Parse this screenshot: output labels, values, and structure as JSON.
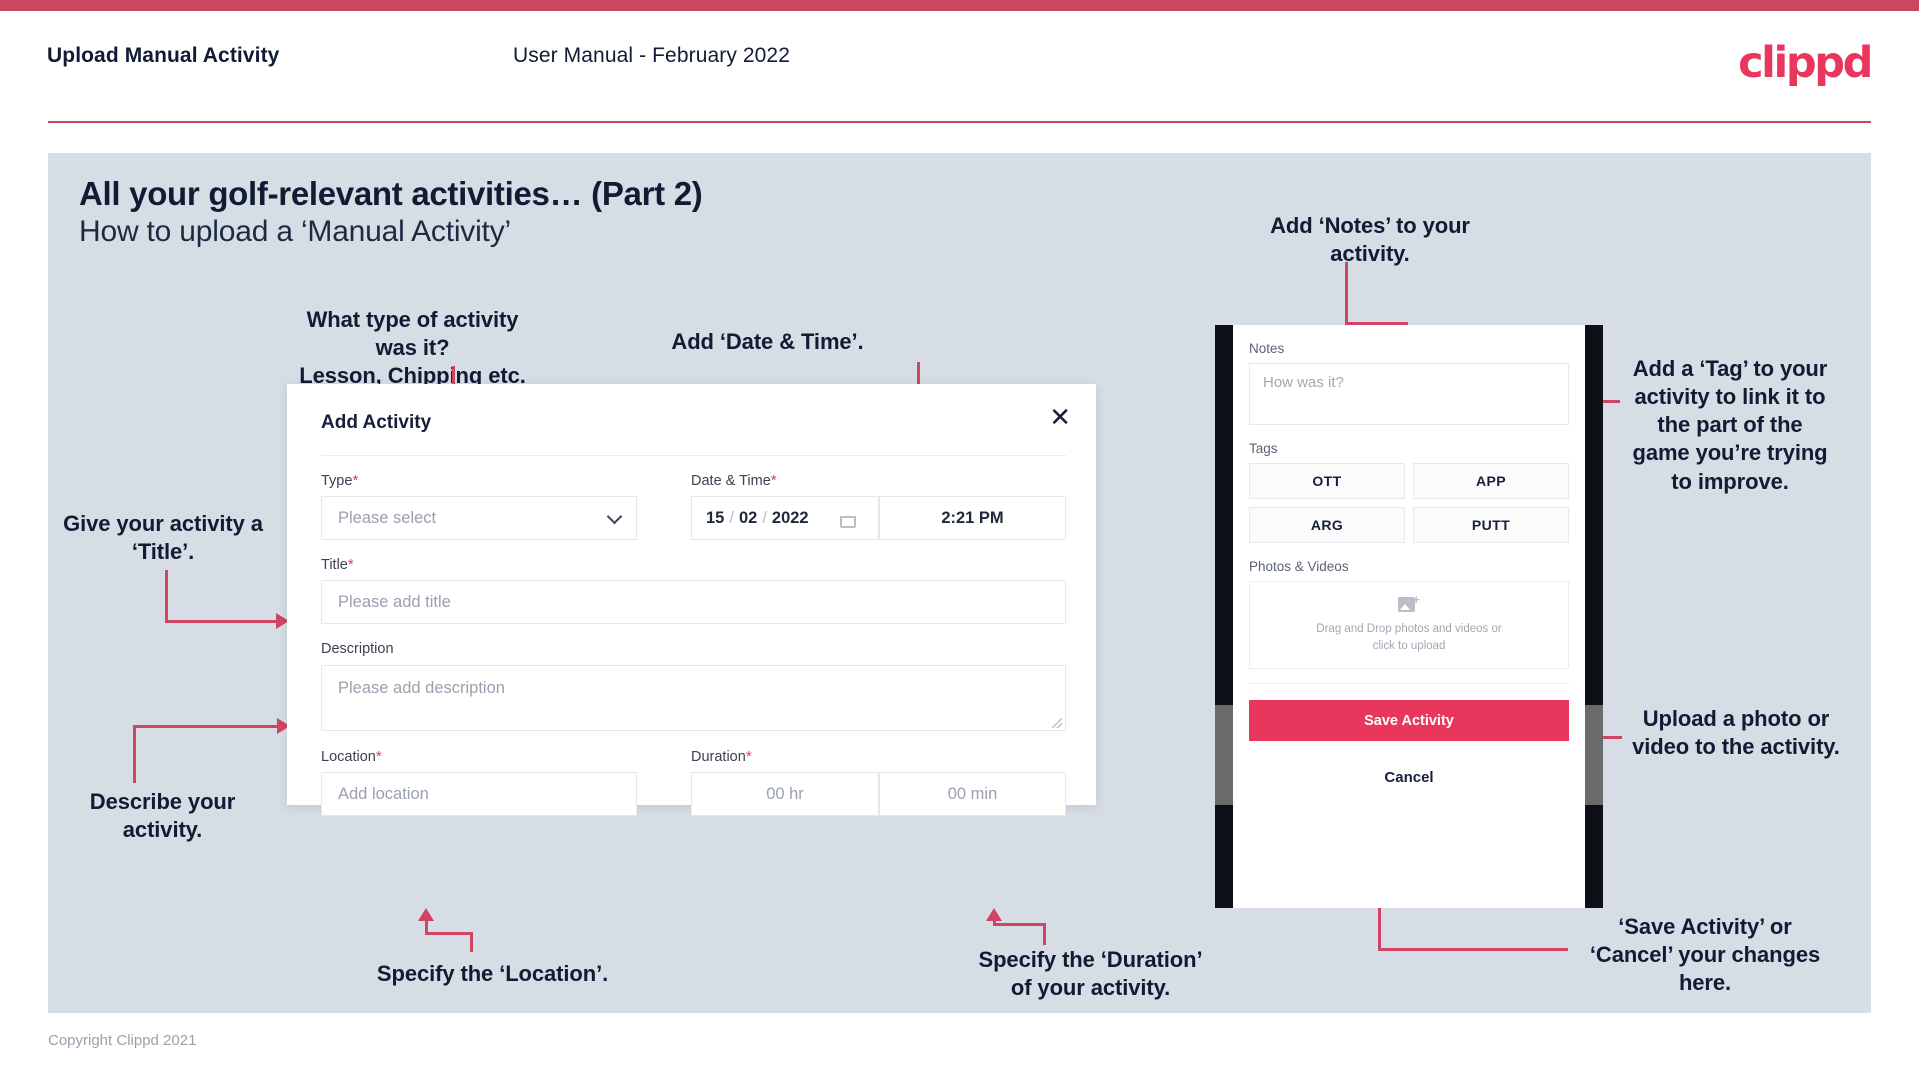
{
  "header": {
    "title": "Upload Manual Activity",
    "subtitle": "User Manual - February 2022",
    "logo": "clippd"
  },
  "slide": {
    "heading": "All your golf-relevant activities… (Part 2)",
    "subheading": "How to upload a ‘Manual Activity’"
  },
  "annotations": {
    "type": "What type of activity was it?\nLesson, Chipping etc.",
    "datetime": "Add ‘Date & Time’.",
    "title": "Give your activity a\n‘Title’.",
    "description": "Describe your\nactivity.",
    "location": "Specify the ‘Location’.",
    "duration": "Specify the ‘Duration’\nof your activity.",
    "notes": "Add ‘Notes’ to your\nactivity.",
    "tags": "Add a ‘Tag’ to your\nactivity to link it to\nthe part of the\ngame you’re trying\nto improve.",
    "upload": "Upload a photo or\nvideo to the activity.",
    "save": "‘Save Activity’ or\n‘Cancel’ your changes\nhere."
  },
  "dialog": {
    "title": "Add Activity",
    "close_icon": "close-icon",
    "fields": {
      "type": {
        "label": "Type",
        "required": "*",
        "placeholder": "Please select"
      },
      "datetime": {
        "label": "Date & Time",
        "required": "*",
        "day": "15",
        "sep1": "/",
        "month": "02",
        "sep2": "/",
        "year": "2022",
        "time": "2:21 PM"
      },
      "title": {
        "label": "Title",
        "required": "*",
        "placeholder": "Please add title"
      },
      "description": {
        "label": "Description",
        "placeholder": "Please add description"
      },
      "location": {
        "label": "Location",
        "required": "*",
        "placeholder": "Add location"
      },
      "duration": {
        "label": "Duration",
        "required": "*",
        "hours": "00 hr",
        "minutes": "00 min"
      }
    }
  },
  "phone": {
    "notes_label": "Notes",
    "notes_placeholder": "How was it?",
    "tags_label": "Tags",
    "tags": [
      "OTT",
      "APP",
      "ARG",
      "PUTT"
    ],
    "photos_label": "Photos & Videos",
    "dropzone_line1": "Drag and Drop photos and videos or",
    "dropzone_line2": "click to upload",
    "save_label": "Save Activity",
    "cancel_label": "Cancel"
  },
  "footer": {
    "copyright": "Copyright Clippd 2021"
  },
  "colors": {
    "accent": "#e8365d",
    "top_bar": "#c9485f",
    "connector": "#cf4563",
    "slide_bg": "#d7dde5",
    "text_dark": "#101c34"
  }
}
